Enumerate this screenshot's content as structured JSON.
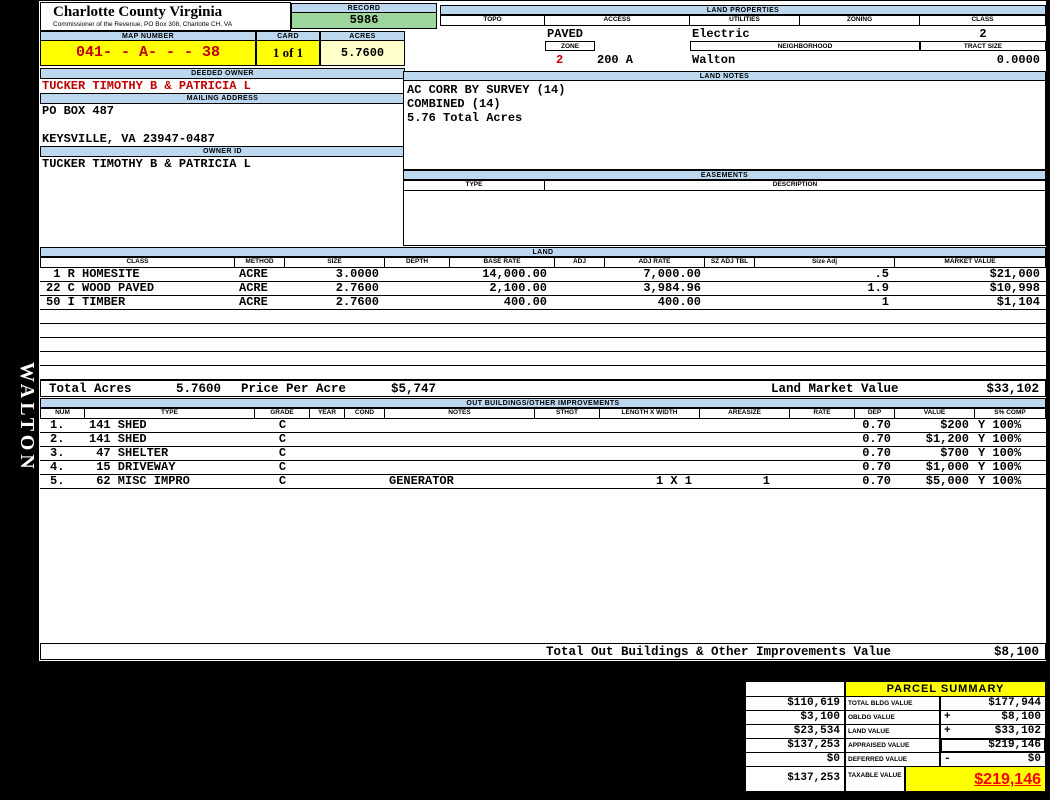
{
  "county": {
    "title": "Charlotte County Virginia",
    "subtitle": "Commissioner of the Revenue, PO Box 308, Charlotte CH, VA"
  },
  "record": {
    "label": "RECORD",
    "value": "5986"
  },
  "map_card_acres": {
    "map_label": "MAP NUMBER",
    "map_value": "041- - A- - - 38",
    "card_label": "CARD",
    "card_value": "1 of 1",
    "acres_label": "ACRES",
    "acres_value": "5.7600"
  },
  "owner": {
    "deeded_label": "DEEDED OWNER",
    "deeded_value": "TUCKER TIMOTHY B & PATRICIA L",
    "mailing_label": "MAILING ADDRESS",
    "address_line1": "PO BOX 487",
    "address_line2": "KEYSVILLE, VA 23947-0487",
    "owner_id_label": "OWNER ID",
    "owner_id_value": "TUCKER TIMOTHY B & PATRICIA L"
  },
  "land_properties": {
    "label": "LAND PROPERTIES",
    "headers": [
      "TOPO",
      "ACCESS",
      "UTILITIES",
      "ZONING",
      "CLASS"
    ],
    "access_value": "PAVED",
    "utilities_value": "Electric",
    "class_value": "2",
    "zone_label": "ZONE",
    "zone_value": "2",
    "zone_code": "200 A",
    "neighborhood_label": "NEIGHBORHOOD",
    "neighborhood_value": "Walton",
    "tract_size_label": "TRACT SIZE",
    "tract_size_value": "0.0000"
  },
  "land_notes": {
    "label": "LAND NOTES",
    "lines": [
      "AC CORR BY SURVEY (14)",
      "COMBINED (14)",
      "5.76 Total Acres"
    ]
  },
  "easements": {
    "label": "EASEMENTS",
    "type_header": "TYPE",
    "description_header": "DESCRIPTION"
  },
  "land": {
    "label": "LAND",
    "columns": [
      "CLASS",
      "METHOD",
      "SIZE",
      "DEPTH",
      "BASE RATE",
      "ADJ",
      "ADJ RATE",
      "SZ ADJ TBL",
      "Size Adj",
      "MARKET VALUE"
    ],
    "rows": [
      [
        " 1 R HOMESITE",
        "ACRE",
        "3.0000",
        "",
        "14,000.00",
        "",
        "7,000.00",
        "",
        ".5",
        "$21,000"
      ],
      [
        "22 C WOOD PAVED",
        "ACRE",
        "2.7600",
        "",
        "2,100.00",
        "",
        "3,984.96",
        "",
        "1.9",
        "$10,998"
      ],
      [
        "50 I TIMBER",
        "ACRE",
        "2.7600",
        "",
        "400.00",
        "",
        "400.00",
        "",
        "1",
        "$1,104"
      ]
    ],
    "total_acres_label": "Total Acres",
    "total_acres_value": "5.7600",
    "price_per_acre_label": "Price Per Acre",
    "price_per_acre_value": "$5,747",
    "market_value_label": "Land Market Value",
    "market_value": "$33,102"
  },
  "out_buildings": {
    "label": "OUT BUILDINGS/OTHER IMPROVEMENTS",
    "columns": [
      "NUM",
      "TYPE",
      "GRADE",
      "YEAR",
      "COND",
      "NOTES",
      "STHGT",
      "LENGTH X WIDTH",
      "AREASIZE",
      "RATE",
      "DEP",
      "VALUE",
      "S% COMP"
    ],
    "rows": [
      [
        "1.",
        "141 SHED",
        "C",
        "",
        "",
        "",
        "",
        "",
        "",
        "",
        "0.70",
        "$200",
        "Y 100%"
      ],
      [
        "2.",
        "141 SHED",
        "C",
        "",
        "",
        "",
        "",
        "",
        "",
        "",
        "0.70",
        "$1,200",
        "Y 100%"
      ],
      [
        "3.",
        " 47 SHELTER",
        "C",
        "",
        "",
        "",
        "",
        "",
        "",
        "",
        "0.70",
        "$700",
        "Y 100%"
      ],
      [
        "4.",
        " 15 DRIVEWAY",
        "C",
        "",
        "",
        "",
        "",
        "",
        "",
        "",
        "0.70",
        "$1,000",
        "Y 100%"
      ],
      [
        "5.",
        " 62 MISC IMPRO",
        "C",
        "",
        "",
        "GENERATOR",
        "",
        "1 X 1",
        "1",
        "",
        "0.70",
        "$5,000",
        "Y 100%"
      ]
    ],
    "total_label": "Total Out Buildings & Other Improvements Value",
    "total_value": "$8,100"
  },
  "parcel_summary": {
    "title": "PARCEL SUMMARY",
    "rows": [
      {
        "prev": "$110,619",
        "label": "TOTAL BLDG VALUE",
        "op": "",
        "cur": "$177,944"
      },
      {
        "prev": "$3,100",
        "label": "OBLDG VALUE",
        "op": "+",
        "cur": "$8,100"
      },
      {
        "prev": "$23,534",
        "label": "LAND VALUE",
        "op": "+",
        "cur": "$33,102"
      },
      {
        "prev": "$137,253",
        "label": "APPRAISED VALUE",
        "op": "",
        "cur": "$219,146"
      },
      {
        "prev": "$0",
        "label": "DEFERRED VALUE",
        "op": "-",
        "cur": "$0"
      }
    ],
    "taxable_prev": "$137,253",
    "taxable_label": "TAXABLE VALUE",
    "taxable_value": "$219,146"
  },
  "sidebar": {
    "district_name": "WALTON"
  },
  "colors": {
    "band_blue": "#BDD7EE",
    "record_green": "#9CD69C",
    "highlight_yellow": "#FFFF00",
    "pale_yellow": "#FFFFC9",
    "dark_red": "#C00000",
    "bright_red": "#FF0000"
  }
}
